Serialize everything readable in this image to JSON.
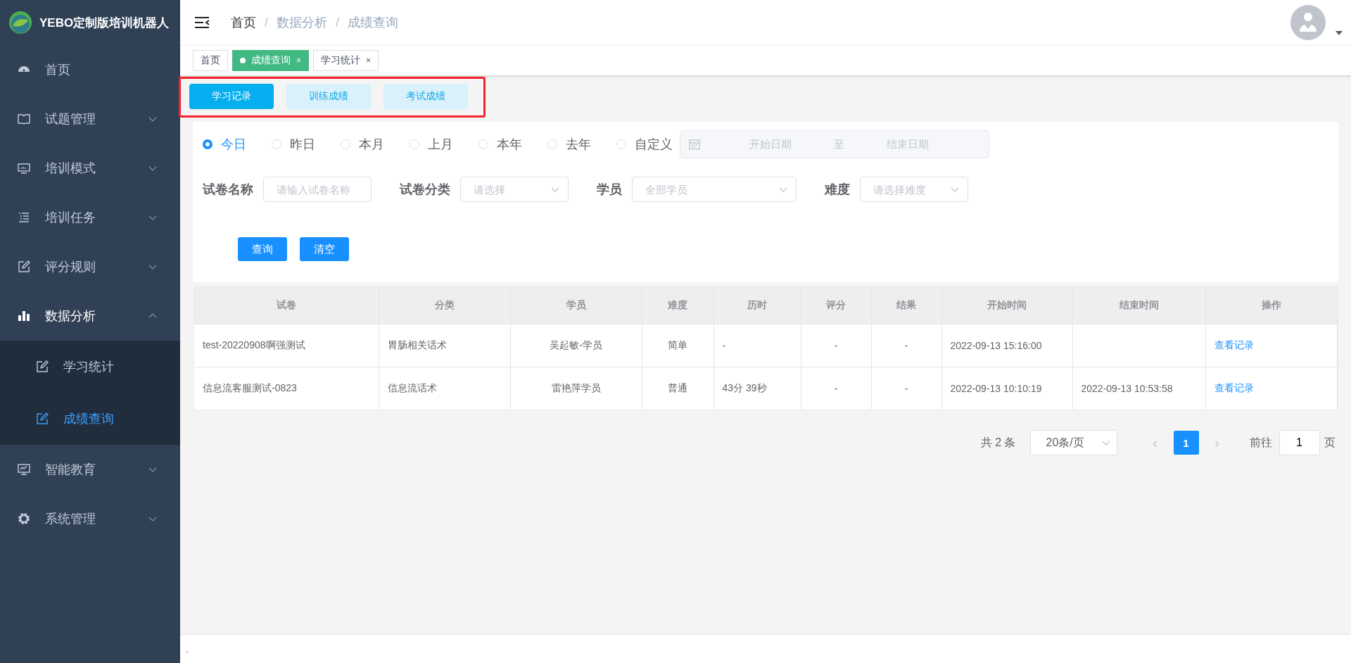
{
  "sidebar": {
    "title": "YEBO定制版培训机器人",
    "items": [
      {
        "label": "首页",
        "expandable": false
      },
      {
        "label": "试题管理",
        "expandable": true,
        "expanded": false
      },
      {
        "label": "培训模式",
        "expandable": true,
        "expanded": false
      },
      {
        "label": "培训任务",
        "expandable": true,
        "expanded": false
      },
      {
        "label": "评分规则",
        "expandable": true,
        "expanded": false
      },
      {
        "label": "数据分析",
        "expandable": true,
        "expanded": true,
        "children": [
          {
            "label": "学习统计",
            "selected": false
          },
          {
            "label": "成绩查询",
            "selected": true
          }
        ]
      },
      {
        "label": "智能教育",
        "expandable": true,
        "expanded": false
      },
      {
        "label": "系统管理",
        "expandable": true,
        "expanded": false
      }
    ]
  },
  "breadcrumb": {
    "separator": "/",
    "items": [
      {
        "label": "首页",
        "current": true
      },
      {
        "label": "数据分析",
        "current": false
      },
      {
        "label": "成绩查询",
        "current": false
      }
    ]
  },
  "tags": [
    {
      "label": "首页",
      "selected": false,
      "closable": false
    },
    {
      "label": "成绩查询",
      "selected": true,
      "closable": true
    },
    {
      "label": "学习统计",
      "selected": false,
      "closable": true
    }
  ],
  "tag_close": "×",
  "record_tabs": [
    {
      "label": "学习记录",
      "selected": true
    },
    {
      "label": "训练成绩",
      "selected": false
    },
    {
      "label": "考试成绩",
      "selected": false
    }
  ],
  "period_options": [
    {
      "label": "今日",
      "selected": true
    },
    {
      "label": "昨日",
      "selected": false
    },
    {
      "label": "本月",
      "selected": false
    },
    {
      "label": "上月",
      "selected": false
    },
    {
      "label": "本年",
      "selected": false
    },
    {
      "label": "去年",
      "selected": false
    },
    {
      "label": "自定义",
      "selected": false
    }
  ],
  "date_range": {
    "start_placeholder": "开始日期",
    "separator": "至",
    "end_placeholder": "结束日期"
  },
  "filters": [
    {
      "kind": "input",
      "label": "试卷名称",
      "placeholder": "请输入试卷名称"
    },
    {
      "kind": "select",
      "label": "试卷分类",
      "placeholder": "请选择"
    },
    {
      "kind": "select",
      "label": "学员",
      "placeholder": "全部学员"
    },
    {
      "kind": "select",
      "label": "难度",
      "placeholder": "请选择难度"
    }
  ],
  "actions": [
    "查询",
    "清空"
  ],
  "table": {
    "columns": [
      "试卷",
      "分类",
      "学员",
      "难度",
      "历时",
      "评分",
      "结果",
      "开始时间",
      "结束时间",
      "操作"
    ],
    "rows": [
      [
        "test-20220908啊强测试",
        "胃肠相关话术",
        "吴起敏-学员",
        "简单",
        "-",
        "-",
        "-",
        "2022-09-13 15:16:00",
        "",
        "查看记录"
      ],
      [
        "信息流客服测试-0823",
        "信息流话术",
        "雷艳萍学员",
        "普通",
        "43分 39秒",
        "-",
        "-",
        "2022-09-13 10:10:19",
        "2022-09-13 10:53:58",
        "查看记录"
      ]
    ]
  },
  "pagination": {
    "total": "共 2 条",
    "page_size": "20条/页",
    "prev": "‹",
    "pages": [
      {
        "label": "1",
        "selected": true
      }
    ],
    "next": "›",
    "goto_label": "前往",
    "goto_value": "1",
    "goto_suffix": "页"
  },
  "footer": "."
}
